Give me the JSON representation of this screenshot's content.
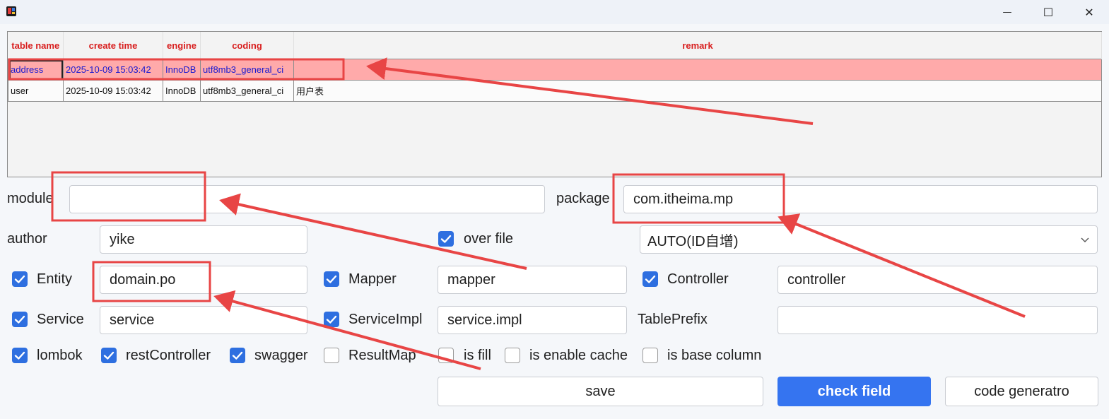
{
  "window": {
    "minimize_glyph": "—",
    "maximize_glyph": "☐",
    "close_glyph": "✕"
  },
  "table": {
    "headers": [
      "table name",
      "create time",
      "engine",
      "coding",
      "remark"
    ],
    "rows": [
      {
        "name": "address",
        "create_time": "2025-10-09 15:03:42",
        "engine": "InnoDB",
        "coding": "utf8mb3_general_ci",
        "remark": ""
      },
      {
        "name": "user",
        "create_time": "2025-10-09 15:03:42",
        "engine": "InnoDB",
        "coding": "utf8mb3_general_ci",
        "remark": "用户表"
      }
    ]
  },
  "form": {
    "module_label": "module",
    "module_value": "",
    "package_label": "package",
    "package_value": "com.itheima.mp",
    "author_label": "author",
    "author_value": "yike",
    "over_file_label": "over file",
    "id_type_value": "AUTO(ID自增)",
    "entity_label": "Entity",
    "entity_value": "domain.po",
    "mapper_label": "Mapper",
    "mapper_value": "mapper",
    "controller_label": "Controller",
    "controller_value": "controller",
    "service_label": "Service",
    "service_value": "service",
    "serviceimpl_label": "ServiceImpl",
    "serviceimpl_value": "service.impl",
    "tableprefix_label": "TablePrefix",
    "tableprefix_value": "",
    "lombok_label": "lombok",
    "restcontroller_label": "restController",
    "swagger_label": "swagger",
    "resultmap_label": "ResultMap",
    "is_fill_label": "is fill",
    "is_enable_cache_label": "is enable cache",
    "is_base_column_label": "is base column"
  },
  "checkboxes": {
    "over_file": true,
    "entity": true,
    "mapper": true,
    "controller": true,
    "service": true,
    "serviceimpl": true,
    "lombok": true,
    "restcontroller": true,
    "swagger": true,
    "resultmap": false,
    "is_fill": false,
    "is_enable_cache": false,
    "is_base_column": false
  },
  "buttons": {
    "save": "save",
    "check_field": "check field",
    "code_generator": "code generatro"
  },
  "colors": {
    "accent": "#3574f0",
    "header_text": "#d81e1e",
    "selected_row": "#ffaaaa",
    "annotation": "#e84545"
  }
}
